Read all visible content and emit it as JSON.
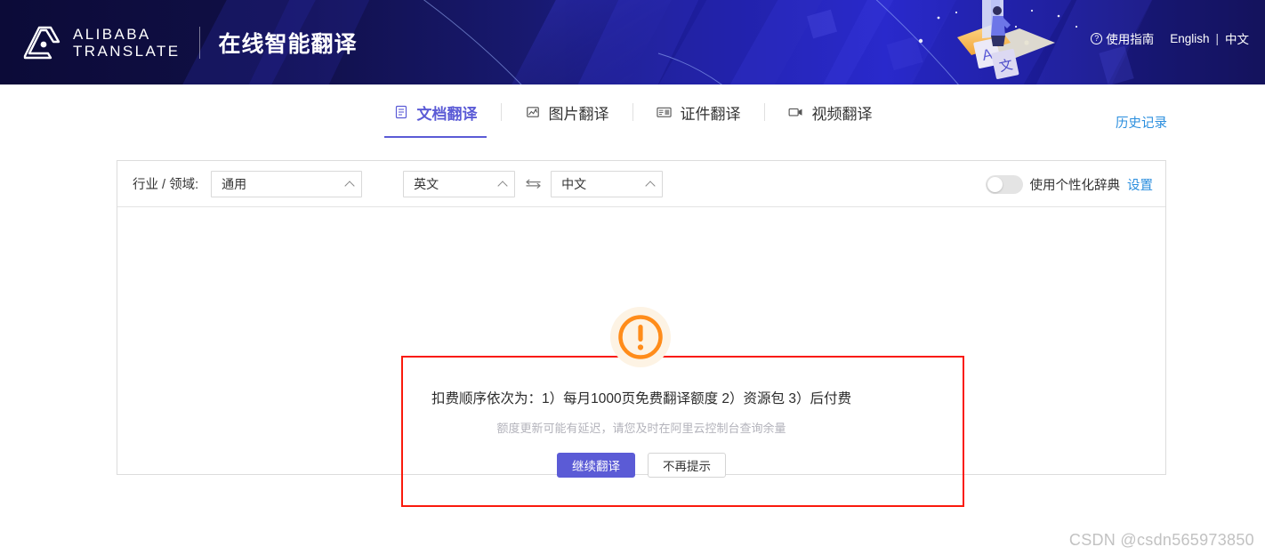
{
  "header": {
    "brand_line1": "ALIBABA",
    "brand_line2": "TRANSLATE",
    "brand_subtitle": "在线智能翻译",
    "guide_icon": "question-circle-icon",
    "guide_label": "使用指南",
    "lang_en": "English",
    "lang_separator": "|",
    "lang_zh": "中文",
    "banner_bg": "#0d0c3c",
    "banner_accent": "#2020b8"
  },
  "tabs": {
    "items": [
      {
        "label": "文档翻译",
        "icon": "document-icon",
        "active": true
      },
      {
        "label": "图片翻译",
        "icon": "image-icon",
        "active": false
      },
      {
        "label": "证件翻译",
        "icon": "id-card-icon",
        "active": false
      },
      {
        "label": "视频翻译",
        "icon": "video-camera-icon",
        "active": false
      }
    ],
    "active_color": "#5b5bd6",
    "history_label": "历史记录",
    "history_color": "#2a8ede"
  },
  "toolbar": {
    "industry_label": "行业 / 领域:",
    "industry_value": "通用",
    "source_lang": "英文",
    "target_lang": "中文",
    "swap_icon": "swap-horizontal-icon",
    "caret_icon": "chevron-up-icon",
    "dictionary_toggle_state": "off",
    "dictionary_label": "使用个性化辞典",
    "settings_label": "设置"
  },
  "warning": {
    "icon": "exclamation-circle-icon",
    "icon_color": "#ff8c1a",
    "icon_bg": "#fdf4e6",
    "main_text": "扣费顺序依次为：1）每月1000页免费翻译额度 2）资源包 3）后付费",
    "sub_text": "额度更新可能有延迟，请您及时在阿里云控制台查询余量",
    "primary_button": "继续翻译",
    "secondary_button": "不再提示",
    "primary_color": "#5b5bd6",
    "highlight_border_color": "#fa1a0c"
  },
  "watermark": {
    "text": "CSDN @csdn565973850"
  }
}
